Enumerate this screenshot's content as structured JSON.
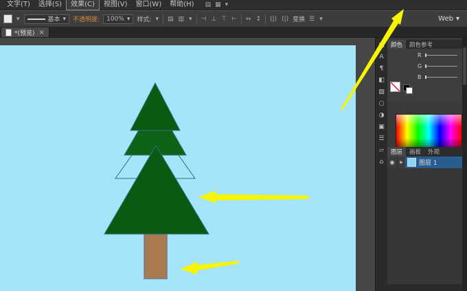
{
  "colors": {
    "canvas": "#a6e4fa",
    "tree_dark": "#0a5a12",
    "tree_mid": "#0e6317",
    "tree_outline": "#2e6f7c",
    "trunk": "#a87a4e",
    "trunk_stroke": "#70788a",
    "arrow": "#f7f500"
  },
  "menubar": {
    "items": [
      "文字(T)",
      "选择(S)",
      "效果(C)",
      "视图(V)",
      "窗口(W)",
      "帮助(H)"
    ],
    "doc_layout_icon": "▤",
    "arrange_icon": "▦",
    "dropdown_icon": "▾"
  },
  "controlbar": {
    "swatch_dropdown_icon": "▾",
    "stroke_profile": "基本",
    "dropdown_icon": "▾",
    "opacity_label": "不透明度:",
    "opacity_value": "100%",
    "style_label": "样式:",
    "icons": [
      "▤",
      "▥",
      "▾",
      "⊣",
      "⊥",
      "⊤",
      "⊢",
      "↔",
      "↕",
      "(|)",
      "(|)",
      "▾"
    ],
    "transform_label": "变换",
    "panel_menu_icon": "☰",
    "workspace": "Web"
  },
  "tabbar": {
    "title": "*(预览)",
    "close_icon": "×"
  },
  "toolstrip": {
    "icons": [
      "▦",
      "A",
      "¶",
      "◧",
      "▨",
      "○",
      "◑",
      "▣",
      "☰",
      "▱",
      "⌂"
    ]
  },
  "color_panel": {
    "tabs": [
      "颜色",
      "颜色参考"
    ],
    "channels": [
      "R",
      "G",
      "B"
    ]
  },
  "layers_panel": {
    "tabs": [
      "图层",
      "画板",
      "外观"
    ],
    "layer_name": "图层 1",
    "eye_icon": "◉",
    "expand_icon": "▶"
  }
}
